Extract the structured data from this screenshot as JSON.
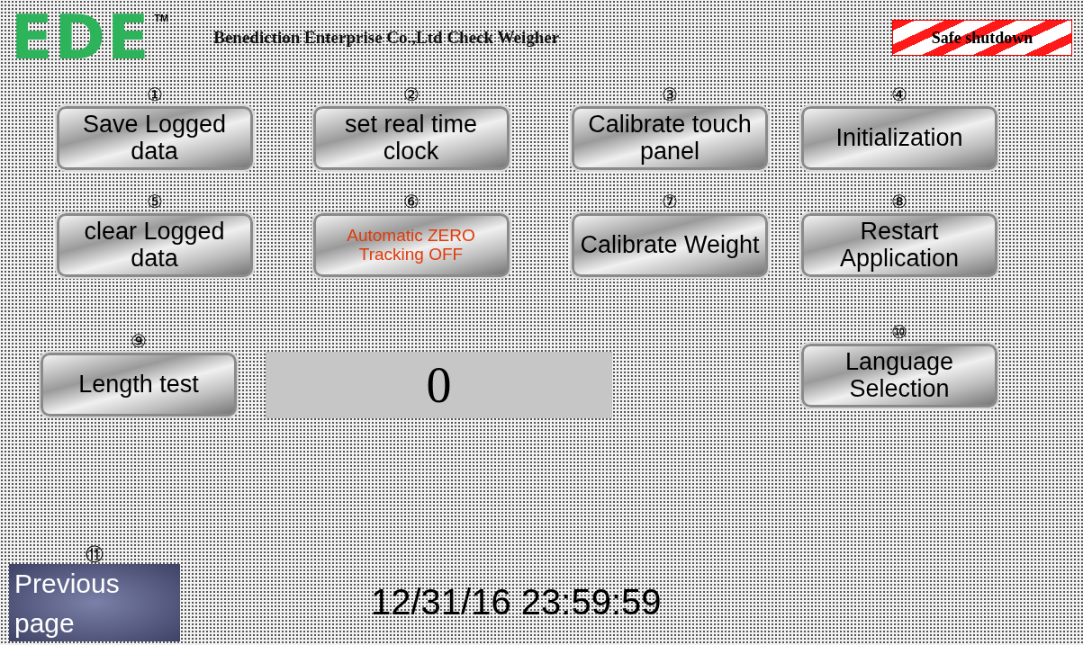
{
  "header": {
    "logo": {
      "text": "EDE",
      "mark": "TM"
    },
    "title": "Benediction Enterprise Co.,Ltd Check Weigher",
    "shutdown_button": "Safe shutdown"
  },
  "buttons": [
    {
      "number": "①",
      "label": "Save Logged data",
      "kind": "normal"
    },
    {
      "number": "②",
      "label": "set real time clock",
      "kind": "normal"
    },
    {
      "number": "③",
      "label": "Calibrate touch panel",
      "kind": "normal"
    },
    {
      "number": "④",
      "label": "Initialization",
      "kind": "normal"
    },
    {
      "number": "⑤",
      "label": "clear Logged data",
      "kind": "normal"
    },
    {
      "number": "⑥",
      "label": "Automatic ZERO Tracking OFF",
      "kind": "toggle"
    },
    {
      "number": "⑦",
      "label": "Calibrate Weight",
      "kind": "normal"
    },
    {
      "number": "⑧",
      "label": "Restart Application",
      "kind": "normal"
    }
  ],
  "length_test": {
    "number": "⑨",
    "label": "Length test"
  },
  "length_display": "0",
  "language_button": {
    "number": "⑩",
    "label": "Language Selection"
  },
  "previous_page": {
    "number": "⑪",
    "label": "Previous page"
  },
  "datetime": "12/31/16 23:59:59"
}
